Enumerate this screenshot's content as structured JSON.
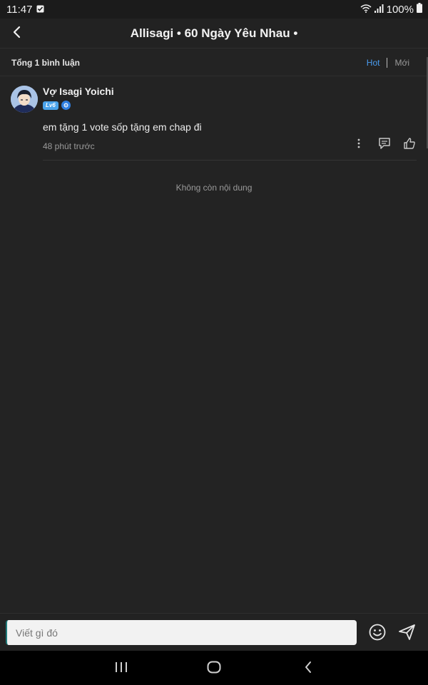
{
  "status_bar": {
    "time": "11:47",
    "battery": "100%",
    "icons": [
      "notification-check-icon",
      "wifi-icon",
      "signal-icon",
      "battery-icon"
    ]
  },
  "header": {
    "title": "Allisagi • 60 Ngày Yêu Nhau •",
    "back_icon": "chevron-left-icon"
  },
  "sort_bar": {
    "total": "Tổng 1 bình luận",
    "hot": "Hot",
    "new": "Mới"
  },
  "comments": [
    {
      "username": "Vợ Isagi Yoichi",
      "level": "Lv6",
      "text": "em tặng 1 vote sốp tặng em chap đi",
      "time": "48 phút trước"
    }
  ],
  "no_more": "Không còn nội dung",
  "composer": {
    "placeholder": "Viết gì đó"
  },
  "colors": {
    "background": "#232323",
    "accent": "#4a9df0",
    "level_badge": "#4aa3ea"
  }
}
